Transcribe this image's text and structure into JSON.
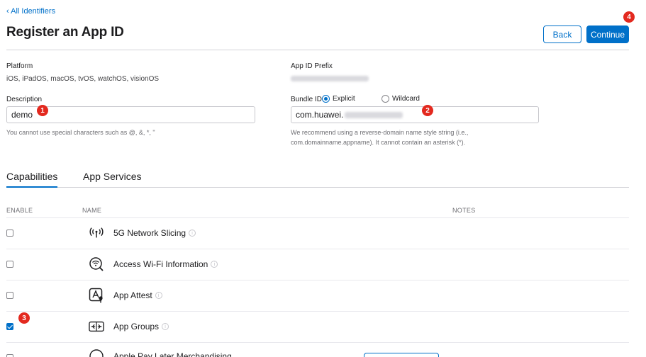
{
  "nav": {
    "back_link": "‹ All Identifiers"
  },
  "header": {
    "title": "Register an App ID",
    "back_label": "Back",
    "continue_label": "Continue"
  },
  "platform": {
    "label": "Platform",
    "value": "iOS, iPadOS, macOS, tvOS, watchOS, visionOS"
  },
  "prefix": {
    "label": "App ID Prefix"
  },
  "description": {
    "label": "Description",
    "value": "demo",
    "help": "You cannot use special characters such as @, &, *, \""
  },
  "bundle": {
    "label": "Bundle ID",
    "option_explicit": "Explicit",
    "option_wildcard": "Wildcard",
    "selected": "Explicit",
    "value": "com.huawei.",
    "help_line1": "We recommend using a reverse-domain name style string (i.e.,",
    "help_line2": "com.domainname.appname). It cannot contain an asterisk (*)."
  },
  "tabs": [
    {
      "label": "Capabilities",
      "active": true
    },
    {
      "label": "App Services",
      "active": false
    }
  ],
  "table": {
    "col_enable": "ENABLE",
    "col_name": "NAME",
    "col_notes": "NOTES",
    "rows": [
      {
        "name": "5G Network Slicing",
        "icon": "antenna-icon",
        "checked": false
      },
      {
        "name": "Access Wi-Fi Information",
        "icon": "wifi-search-icon",
        "checked": false
      },
      {
        "name": "App Attest",
        "icon": "app-attest-icon",
        "checked": false
      },
      {
        "name": "App Groups",
        "icon": "app-groups-icon",
        "checked": true
      },
      {
        "name": "Apple Pay Later Merchandising",
        "icon": "apple-pay-icon",
        "checked": false
      }
    ]
  },
  "badges": {
    "b1": "1",
    "b2": "2",
    "b3": "3",
    "b4": "4"
  },
  "colors": {
    "accent": "#0070c9",
    "badge": "#e3291f"
  }
}
